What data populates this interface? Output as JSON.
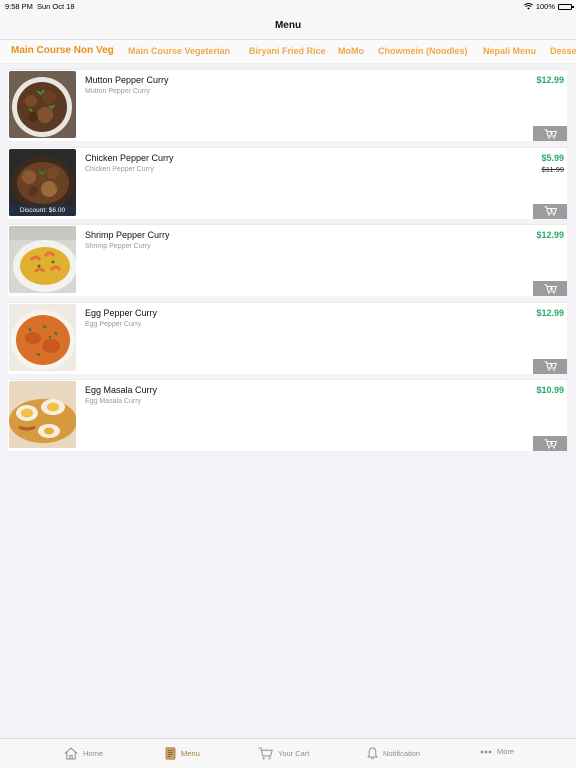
{
  "status_bar": {
    "time": "9:58 PM",
    "date": "Sun Oct 18",
    "battery": "100%"
  },
  "nav": {
    "title": "Menu"
  },
  "categories": [
    {
      "label": "Main Course Non Veg",
      "active": true
    },
    {
      "label": "Main Course Vegeterian",
      "active": false
    },
    {
      "label": "Biryani Fried Rice",
      "active": false
    },
    {
      "label": "MoMo",
      "active": false
    },
    {
      "label": "Chowmein (Noodles)",
      "active": false
    },
    {
      "label": "Nepali Menu",
      "active": false
    },
    {
      "label": "Desse",
      "active": false
    }
  ],
  "items": [
    {
      "name": "Mutton Pepper Curry",
      "sub": "Mutton Pepper Curry",
      "price": "$12.99"
    },
    {
      "name": "Chicken Pepper Curry",
      "sub": "Chicken Pepper Curry",
      "price": "$5.99",
      "old_price": "$11.99",
      "discount": "Discount: $6.00"
    },
    {
      "name": "Shrimp Pepper Curry",
      "sub": "Shrimp Pepper Curry",
      "price": "$12.99"
    },
    {
      "name": "Egg Pepper Curry",
      "sub": "Egg Pepper Curry",
      "price": "$12.99"
    },
    {
      "name": "Egg Masala Curry",
      "sub": "Egg Masala Curry",
      "price": "$10.99"
    }
  ],
  "tabs": [
    {
      "label": "Home",
      "icon": "home-icon"
    },
    {
      "label": "Menu",
      "icon": "menu-book-icon",
      "active": true
    },
    {
      "label": "Your Cart",
      "icon": "cart-icon"
    },
    {
      "label": "Notification",
      "icon": "bell-icon"
    },
    {
      "label": "More",
      "icon": "more-dots-icon"
    }
  ],
  "colors": {
    "accent": "#e8901a",
    "price": "#2aa86a",
    "cart_button": "#9c9c9c"
  }
}
